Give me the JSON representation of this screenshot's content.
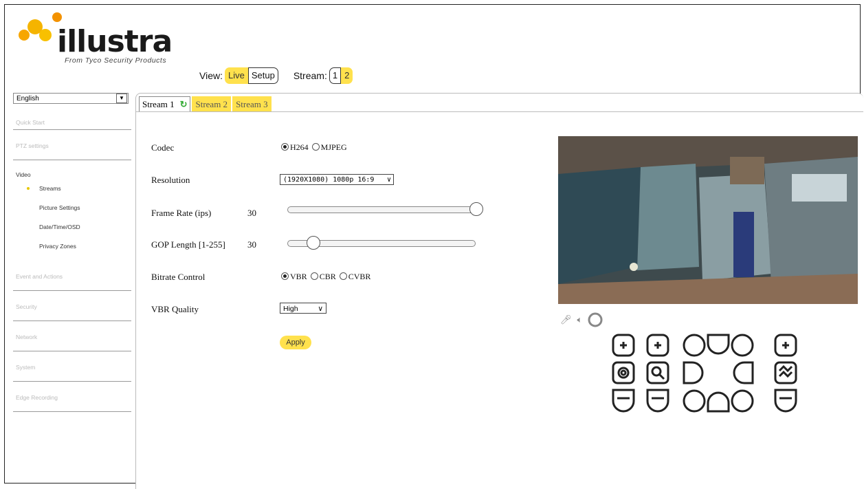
{
  "header": {
    "logo_text": "illustra",
    "logo_tagline": "From Tyco Security Products",
    "view_label": "View:",
    "view_options": [
      "Live",
      "Setup"
    ],
    "stream_label": "Stream:",
    "stream_options": [
      "1",
      "2"
    ]
  },
  "sidebar": {
    "language": "English",
    "sections": {
      "quick_start": "Quick Start",
      "ptz_settings": "PTZ settings",
      "video": "Video",
      "events": "Event and Actions",
      "security": "Security",
      "network": "Network",
      "system": "System",
      "edge_recording": "Edge Recording"
    },
    "video_items": [
      "Streams",
      "Picture Settings",
      "Date/Time/OSD",
      "Privacy Zones"
    ]
  },
  "tabs": [
    "Stream 1",
    "Stream 2",
    "Stream 3"
  ],
  "form": {
    "codec_label": "Codec",
    "codec_options": [
      "H264",
      "MJPEG"
    ],
    "resolution_label": "Resolution",
    "resolution_value": "(1920X1080) 1080p 16:9",
    "frame_rate_label": "Frame Rate (ips)",
    "frame_rate_value": "30",
    "frame_rate_fraction": 1.0,
    "gop_label": "GOP Length [1-255]",
    "gop_value": "30",
    "gop_fraction": 0.12,
    "bitrate_label": "Bitrate Control",
    "bitrate_options": [
      "VBR",
      "CBR",
      "CVBR"
    ],
    "vbr_quality_label": "VBR Quality",
    "vbr_quality_value": "High",
    "apply_label": "Apply"
  },
  "colors": {
    "accent": "#ffe14d"
  }
}
